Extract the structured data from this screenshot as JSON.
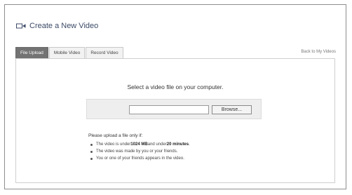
{
  "header": {
    "title": "Create a New Video"
  },
  "tabs": [
    {
      "label": "File Upload",
      "active": true
    },
    {
      "label": "Mobile Video",
      "active": false
    },
    {
      "label": "Record Video",
      "active": false
    }
  ],
  "back_link": "Back to My Videos",
  "upload": {
    "prompt": "Select a video file on your computer.",
    "file_value": "",
    "browse_label": "Browse..."
  },
  "rules": {
    "heading": "Please upload a file only if:",
    "items": [
      {
        "before": "The video is under ",
        "strong1": "1024 MB",
        "middle": " and under ",
        "strong2": "20 minutes",
        "after": "."
      },
      {
        "text": "The video was made by you or your friends."
      },
      {
        "text": "You or one of your friends appears in the video."
      }
    ]
  },
  "colors": {
    "active_tab": "#737373",
    "border": "#cfcfcf",
    "title": "#3b4a66"
  }
}
